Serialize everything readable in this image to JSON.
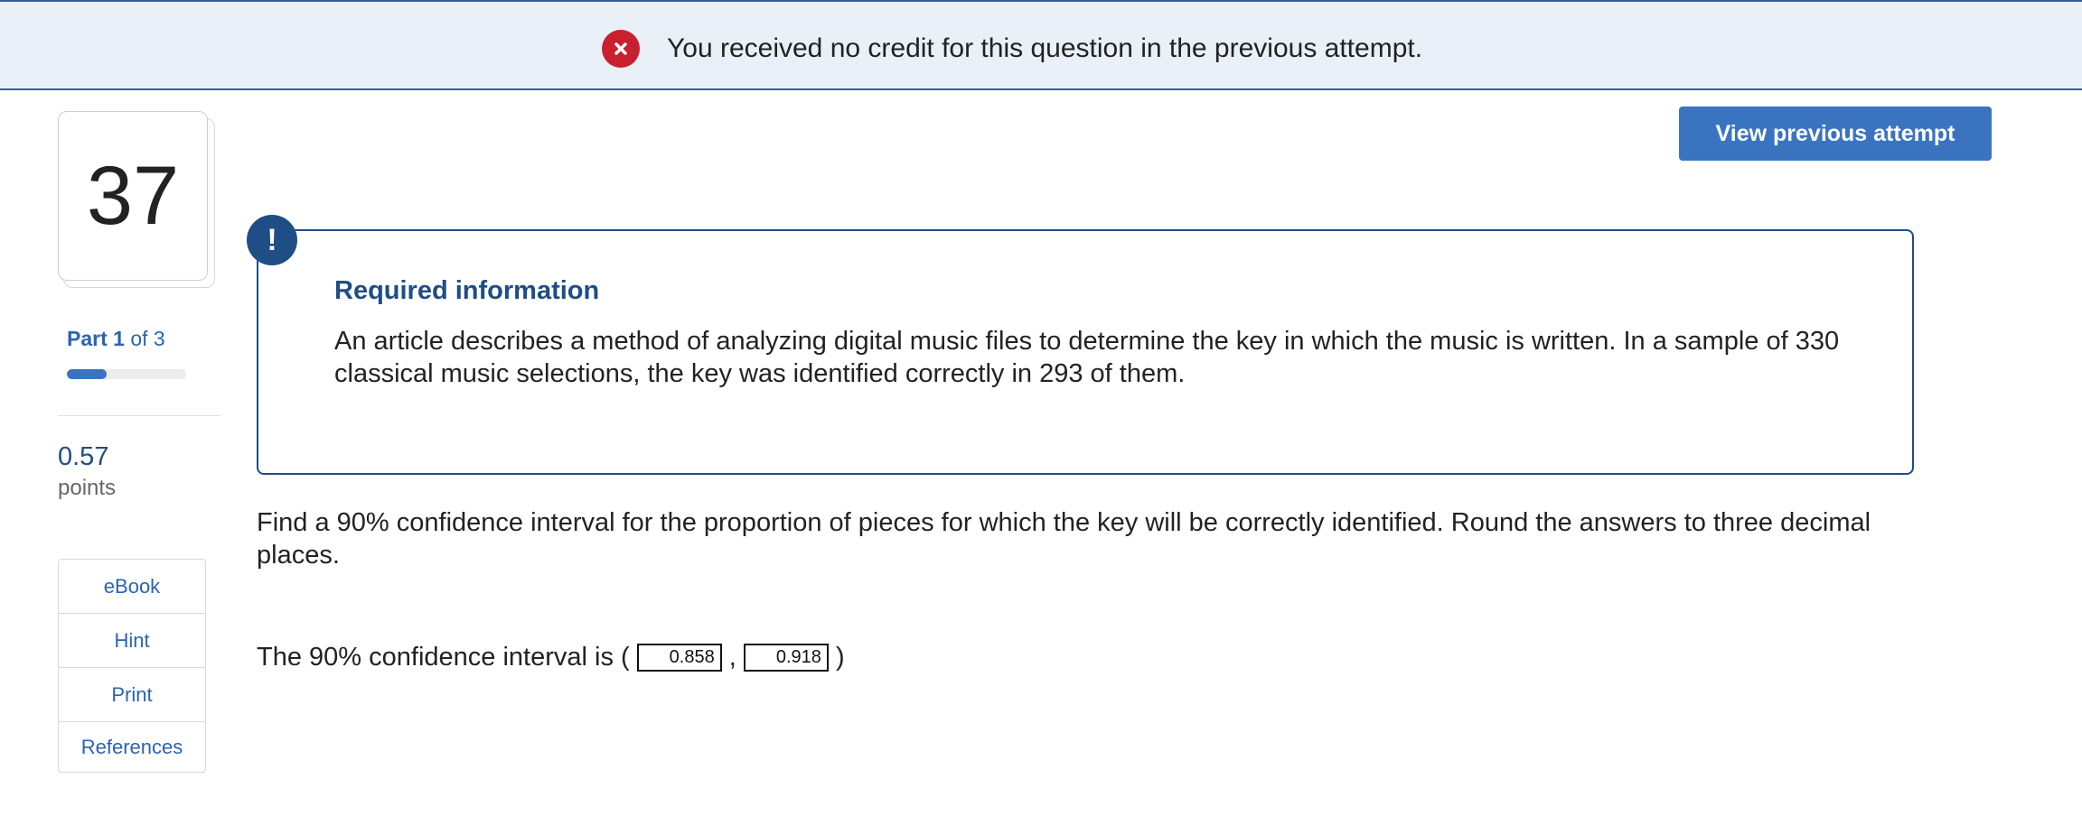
{
  "banner": {
    "icon": "error-x-icon",
    "icon_color": "#c8202f",
    "message": "You received no credit for this question in the previous attempt."
  },
  "header": {
    "view_previous_label": "View previous attempt"
  },
  "question_nav": {
    "number": "37",
    "part_word": "Part",
    "part_current": "1",
    "part_of": "of 3",
    "progress_fraction": 0.333,
    "points_value": "0.57",
    "points_label": "points"
  },
  "tools": [
    {
      "label": "eBook"
    },
    {
      "label": "Hint"
    },
    {
      "label": "Print"
    },
    {
      "label": "References"
    }
  ],
  "info": {
    "icon": "exclamation-icon",
    "title": "Required information",
    "text": "An article describes a method of analyzing digital music files to determine the key in which the music is written. In a sample of 330 classical music selections, the key was identified correctly in 293 of them."
  },
  "question": {
    "prompt": "Find a 90% confidence interval for the proportion of pieces for which the key will be correctly identified. Round the answers to three decimal places.",
    "answer_prefix": "The 90% confidence interval is (",
    "answer_separator": ",",
    "answer_suffix": ")",
    "lower_value": "0.858",
    "upper_value": "0.918"
  },
  "colors": {
    "accent": "#3a74c0",
    "navy": "#1f4d85",
    "banner_bg": "#e9f0f8",
    "error": "#c8202f"
  }
}
